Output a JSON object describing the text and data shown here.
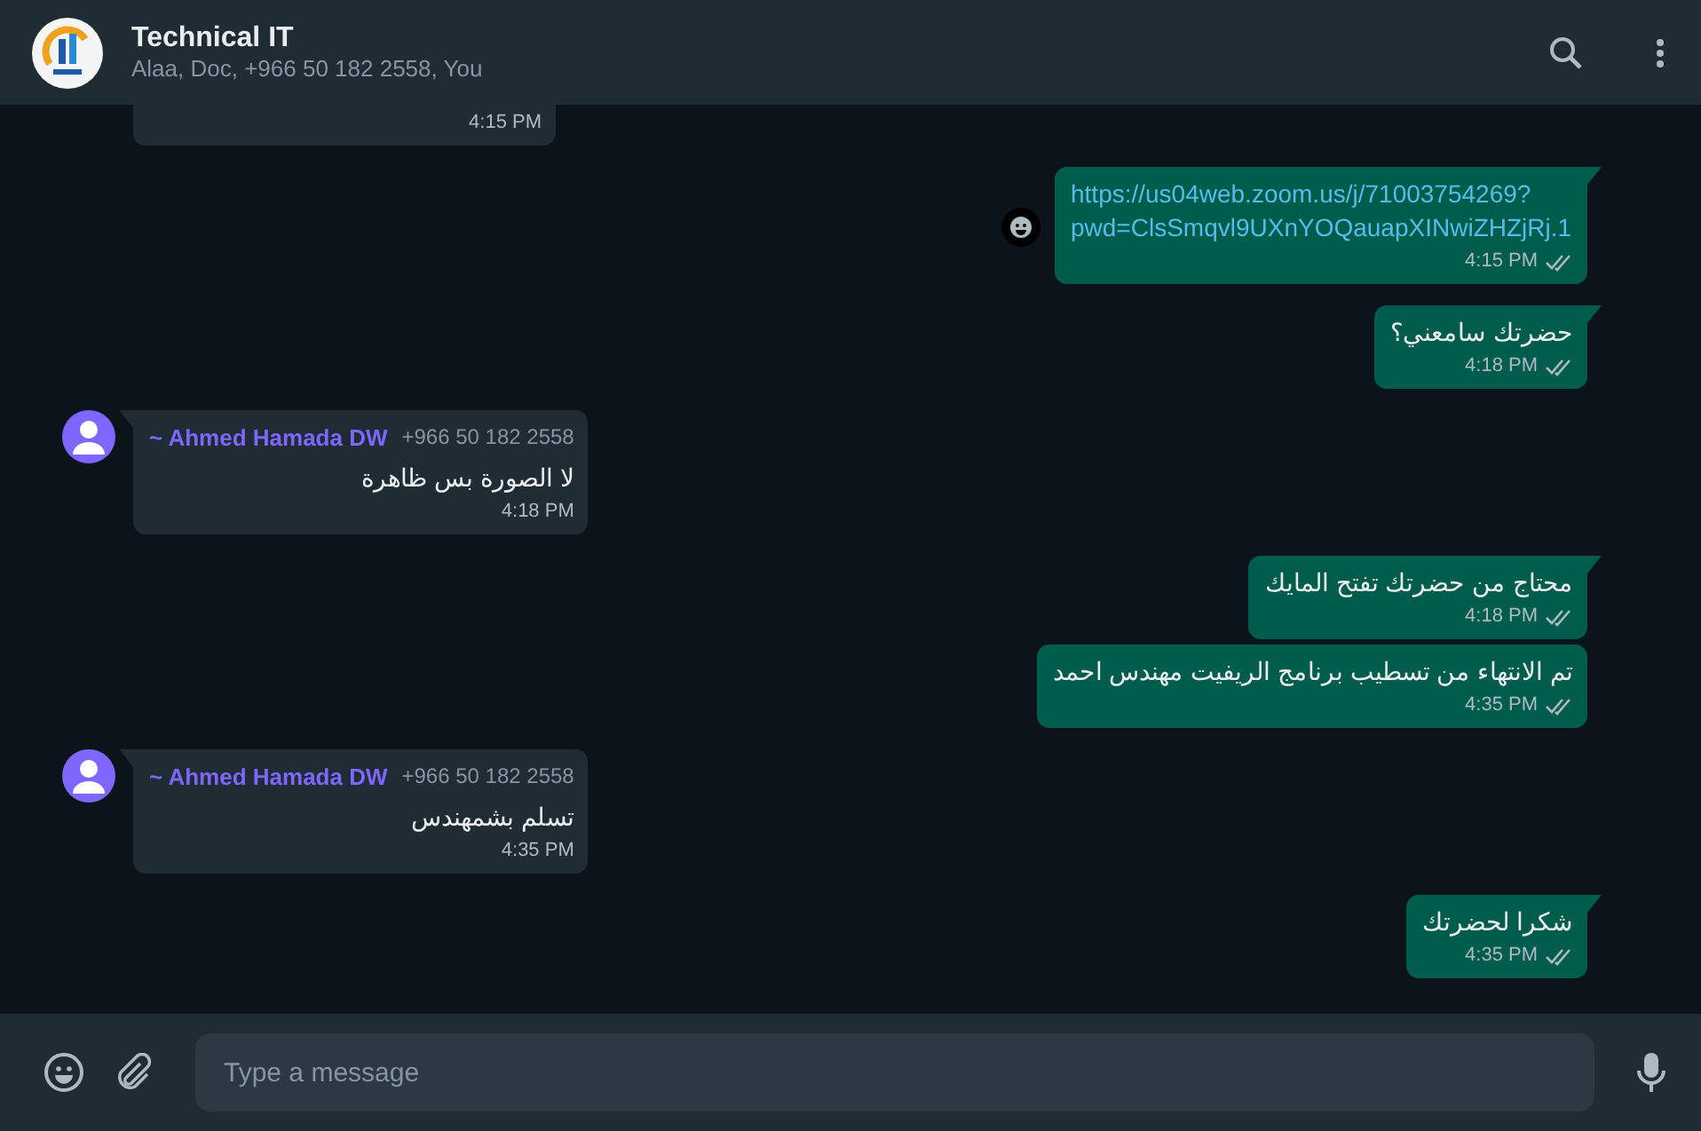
{
  "header": {
    "title": "Technical IT",
    "subtitle": "Alaa, Doc, +966 50 182 2558, You"
  },
  "messages": [
    {
      "kind": "incoming",
      "tail": false,
      "time": "4:15 PM"
    },
    {
      "kind": "outgoing",
      "tail": true,
      "link": "https://us04web.zoom.us/j/71003754269?pwd=ClsSmqvl9UXnYOQauapXINwiZHZjRj.1",
      "time": "4:15 PM",
      "read": false
    },
    {
      "kind": "outgoing",
      "tail": true,
      "text": "حضرتك سامعني؟",
      "time": "4:18 PM",
      "read": false
    },
    {
      "kind": "incoming",
      "tail": true,
      "sender": "~ Ahmed Hamada DW",
      "phone": "+966 50 182 2558",
      "text": "لا الصورة بس ظاهرة",
      "time": "4:18 PM"
    },
    {
      "kind": "outgoing",
      "tail": true,
      "text": "محتاج من حضرتك تفتح المايك",
      "time": "4:18 PM",
      "read": false
    },
    {
      "kind": "outgoing",
      "tail": false,
      "text": "تم الانتهاء من تسطيب برنامج الريفيت مهندس احمد",
      "time": "4:35 PM",
      "read": false
    },
    {
      "kind": "incoming",
      "tail": true,
      "sender": "~ Ahmed Hamada DW",
      "phone": "+966 50 182 2558",
      "text": "تسلم بشمهندس",
      "time": "4:35 PM"
    },
    {
      "kind": "outgoing",
      "tail": true,
      "text": "شكرا لحضرتك",
      "time": "4:35 PM",
      "read": false
    }
  ],
  "composer": {
    "placeholder": "Type a message"
  }
}
